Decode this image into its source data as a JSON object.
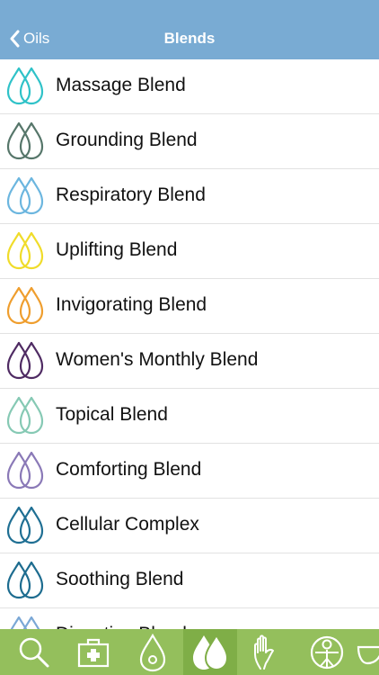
{
  "navbar": {
    "back_label": "Oils",
    "title": "Blends",
    "background": "#79abd3"
  },
  "items": [
    {
      "label": "Massage Blend",
      "color": "#2fc2c8",
      "icon": "drop-pair-icon"
    },
    {
      "label": "Grounding Blend",
      "color": "#56766a",
      "icon": "drop-pair-icon"
    },
    {
      "label": "Respiratory Blend",
      "color": "#6cb6df",
      "icon": "drop-pair-icon"
    },
    {
      "label": "Uplifting Blend",
      "color": "#f0dc2a",
      "icon": "drop-pair-icon"
    },
    {
      "label": "Invigorating Blend",
      "color": "#ef9e2e",
      "icon": "drop-pair-icon"
    },
    {
      "label": "Women's Monthly Blend",
      "color": "#4f2b63",
      "icon": "drop-pair-icon"
    },
    {
      "label": "Topical Blend",
      "color": "#86c9b4",
      "icon": "drop-pair-icon"
    },
    {
      "label": "Comforting Blend",
      "color": "#8a79b7",
      "icon": "drop-pair-icon"
    },
    {
      "label": "Cellular Complex",
      "color": "#1f6f93",
      "icon": "drop-pair-icon"
    },
    {
      "label": "Soothing Blend",
      "color": "#1d6c8f",
      "icon": "drop-pair-icon"
    },
    {
      "label": "Digestive Blend",
      "color": "#7ba8d6",
      "icon": "drop-pair-icon"
    }
  ],
  "tabbar": {
    "background": "#94bf5c",
    "active_background": "#7fae47",
    "tabs": [
      {
        "icon": "search-icon",
        "active": false
      },
      {
        "icon": "first-aid-icon",
        "active": false
      },
      {
        "icon": "single-drop-icon",
        "active": false
      },
      {
        "icon": "double-drop-icon",
        "active": true
      },
      {
        "icon": "hand-icon",
        "active": false
      },
      {
        "icon": "body-systems-icon",
        "active": false
      },
      {
        "icon": "bowl-icon",
        "active": false
      }
    ]
  }
}
